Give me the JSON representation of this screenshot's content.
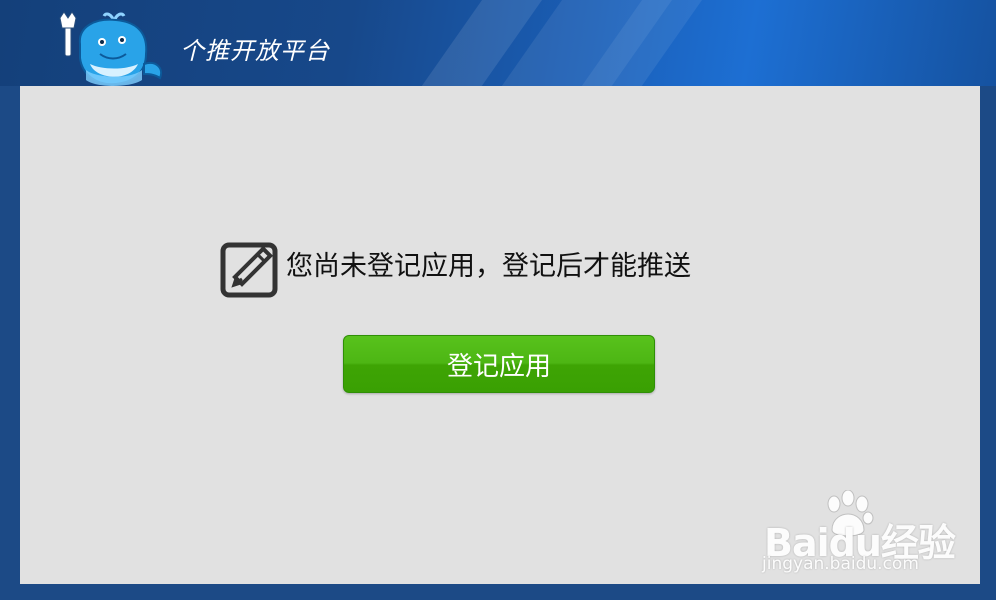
{
  "header": {
    "title": "个推开放平台",
    "mascot_icon": "whale-mascot-icon"
  },
  "main": {
    "notice_icon": "edit-note-icon",
    "notice_text": "您尚未登记应用，登记后才能推送",
    "register_button_label": "登记应用"
  },
  "watermark": {
    "logo_text": "Baidu经验",
    "url_text": "jingyan.baidu.com"
  },
  "colors": {
    "header_bg": "#17488a",
    "content_bg": "#e1e1e1",
    "button_green": "#4db614",
    "frame_blue": "#1c4a86"
  }
}
